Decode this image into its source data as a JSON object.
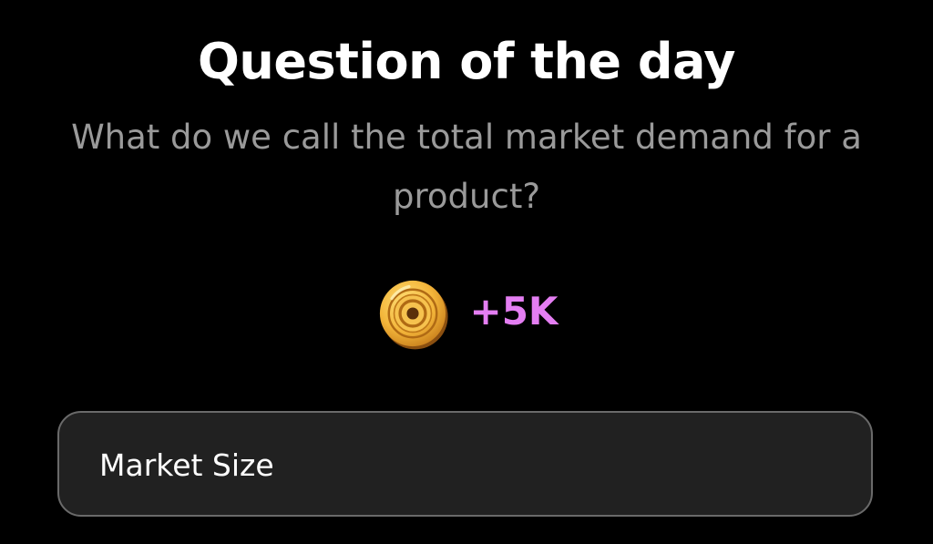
{
  "header": {
    "title": "Question of the day"
  },
  "question": {
    "text": "What do we call the total market demand for a product?"
  },
  "reward": {
    "icon": "coin-icon",
    "amount": "+5K",
    "amount_color": "#e47ef2"
  },
  "answers": [
    {
      "label": "Market Size"
    }
  ],
  "colors": {
    "background": "#000000",
    "title": "#ffffff",
    "question": "#9a9a9a",
    "answer_background": "#212121",
    "answer_border": "#6a6a6a"
  }
}
